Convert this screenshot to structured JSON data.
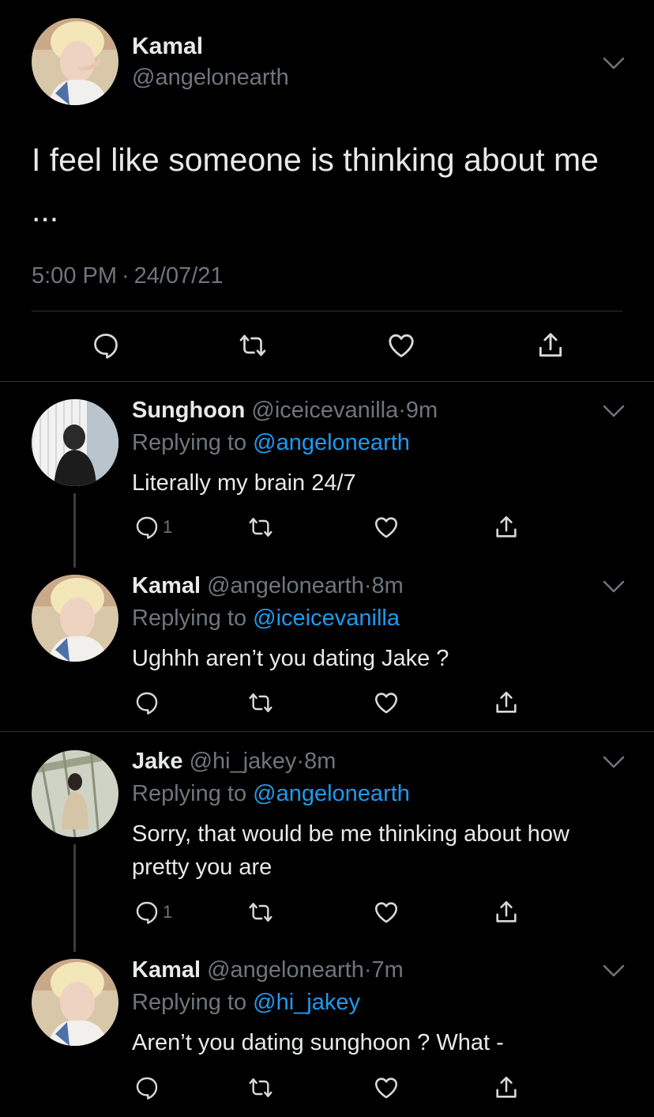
{
  "main": {
    "name": "Kamal",
    "handle": "@angelonearth",
    "text": "I feel like someone is thinking about me ...",
    "time": "5:00 PM",
    "dot": "·",
    "date": "24/07/21"
  },
  "replies": [
    {
      "name": "Sunghoon",
      "handle": "@iceicevanilla",
      "dot": "·",
      "age": "9m",
      "replying_prefix": "Replying to",
      "replying_to": "@angelonearth",
      "text": "Literally my brain 24/7",
      "reply_count": "1"
    },
    {
      "name": "Kamal",
      "handle": "@angelonearth",
      "dot": "·",
      "age": "8m",
      "replying_prefix": "Replying to",
      "replying_to": "@iceicevanilla",
      "text": "Ughhh aren’t you dating Jake ?",
      "reply_count": ""
    },
    {
      "name": "Jake",
      "handle": "@hi_jakey",
      "dot": "·",
      "age": "8m",
      "replying_prefix": "Replying to",
      "replying_to": "@angelonearth",
      "text": "Sorry, that would be me thinking about how pretty you are",
      "reply_count": "1"
    },
    {
      "name": "Kamal",
      "handle": "@angelonearth",
      "dot": "·",
      "age": "7m",
      "replying_prefix": "Replying to",
      "replying_to": "@hi_jakey",
      "text": "Aren’t you dating sunghoon ? What -",
      "reply_count": ""
    }
  ],
  "colors": {
    "background": "#000000",
    "text": "#e7e9ea",
    "muted": "#6e767d",
    "link": "#1d9bf0",
    "divider": "#2f3336"
  },
  "icons": [
    "reply-icon",
    "retweet-icon",
    "like-icon",
    "share-icon",
    "chevron-down-icon",
    "avatar"
  ]
}
